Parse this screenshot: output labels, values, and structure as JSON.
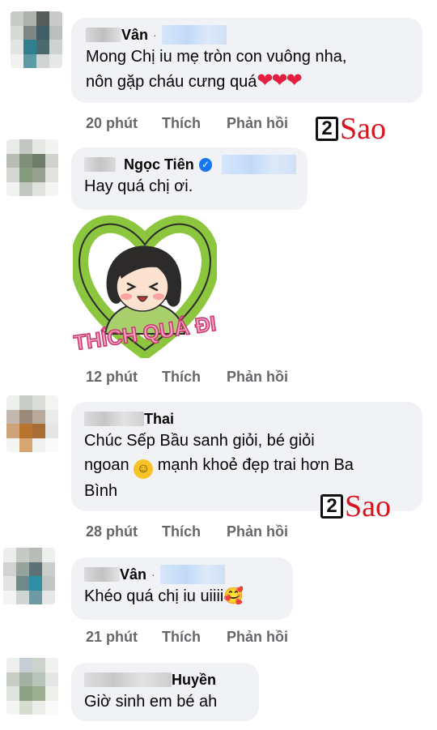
{
  "brand": {
    "logo_number": "2",
    "logo_text": "Sao",
    "logo_color": "#d6161f"
  },
  "comments": [
    {
      "name": "Vân",
      "separator": "·",
      "text_line1": "Mong Chị iu mẹ tròn con vuông nha,",
      "text_line2": "nôn gặp cháu cưng quá",
      "emoji": "❤❤❤",
      "time": "20 phút",
      "like": "Thích",
      "reply": "Phản hồi"
    },
    {
      "name": "Ngọc Tiên",
      "verified_icon": "✓",
      "text_line1": "Hay quá chị ơi.",
      "sticker_text": "THÍCH QUÁ ĐI",
      "time": "12 phút",
      "like": "Thích",
      "reply": "Phản hồi"
    },
    {
      "name": "Thai",
      "text_line1": "Chúc Sếp Bầu sanh giỏi, bé giỏi",
      "text_line2a": "ngoan",
      "smile": "☺",
      "text_line2b": "mạnh khoẻ đẹp trai hơn Ba",
      "text_line3": "Bình",
      "time": "28 phút",
      "like": "Thích",
      "reply": "Phản hồi"
    },
    {
      "name": "Vân",
      "separator": "·",
      "text_line1": "Khéo quá chị iu uiiii",
      "emoji": "🥰",
      "time": "21 phút",
      "like": "Thích",
      "reply": "Phản hồi"
    },
    {
      "name": "Huyền",
      "text_line1": "Giờ sinh em bé ah"
    }
  ]
}
